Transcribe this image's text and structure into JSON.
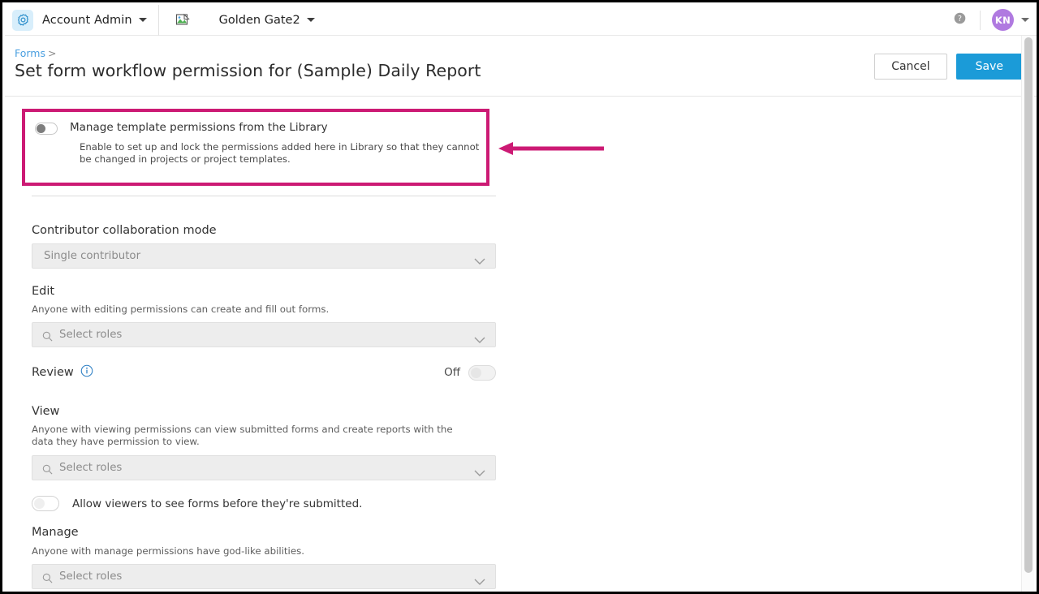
{
  "topbar": {
    "gear_icon": "gear-icon",
    "account_label": "Account Admin",
    "project_icon": "broken-image-icon",
    "project_label": "Golden Gate2",
    "help_icon": "help-circle-icon",
    "avatar_initials": "KN"
  },
  "header": {
    "breadcrumb_root": "Forms",
    "breadcrumb_separator": ">",
    "title": "Set form workflow permission for (Sample) Daily Report",
    "cancel_label": "Cancel",
    "save_label": "Save"
  },
  "highlight": {
    "toggle_state": "off",
    "toggle_label": "Manage template permissions from the Library",
    "description": "Enable to set up and lock the permissions added here in Library so that they cannot be changed in projects or project templates.",
    "border_color": "#cc1a74"
  },
  "annotation": {
    "arrow_color": "#cc1a74",
    "arrow_direction": "left"
  },
  "form": {
    "collaboration": {
      "label": "Contributor collaboration mode",
      "value": "Single contributor"
    },
    "edit": {
      "label": "Edit",
      "description": "Anyone with editing permissions can create and fill out forms.",
      "placeholder": "Select roles"
    },
    "review": {
      "label": "Review",
      "info_icon": "info-circle-icon",
      "state_text": "Off",
      "toggle_state": "off"
    },
    "view": {
      "label": "View",
      "description": "Anyone with viewing permissions can view submitted forms and create reports with the data they have permission to view.",
      "placeholder": "Select roles"
    },
    "allow_viewers": {
      "toggle_state": "off",
      "label": "Allow viewers to see forms before they're submitted."
    },
    "manage": {
      "label": "Manage",
      "description": "Anyone with manage permissions have god-like abilities.",
      "placeholder": "Select roles"
    }
  },
  "colors": {
    "accent_blue": "#1b9bd8",
    "link_blue": "#4a9fe0",
    "highlight_pink": "#cc1a74",
    "avatar_purple": "#b07ae0"
  }
}
